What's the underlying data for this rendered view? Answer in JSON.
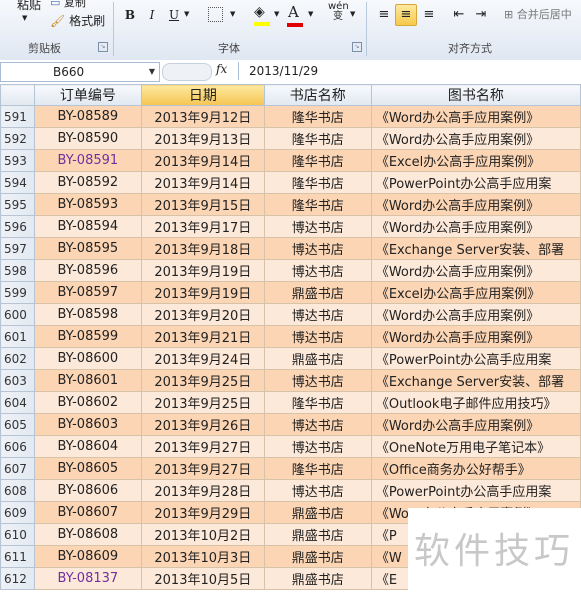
{
  "ribbon": {
    "clipboard": {
      "paste": "粘贴",
      "copy": "复制",
      "format_painter": "格式刷",
      "group": "剪贴板"
    },
    "font": {
      "group": "字体",
      "bold": "B",
      "italic": "I",
      "underline": "U",
      "wen": "wén 变"
    },
    "align": {
      "group": "对齐方式",
      "merge": "合并后居中"
    }
  },
  "formula_bar": {
    "name_box": "B660",
    "fx": "fx",
    "content": "2013/11/29"
  },
  "columns": {
    "a": "订单编号",
    "b": "日期",
    "c": "书店名称",
    "d": "图书名称"
  },
  "rows": [
    {
      "n": "591",
      "id": "BY-08589",
      "date": "2013年9月12日",
      "store": "隆华书店",
      "book": "《Word办公高手应用案例》"
    },
    {
      "n": "592",
      "id": "BY-08590",
      "date": "2013年9月13日",
      "store": "隆华书店",
      "book": "《Word办公高手应用案例》"
    },
    {
      "n": "593",
      "id": "BY-08591",
      "date": "2013年9月14日",
      "store": "隆华书店",
      "book": "《Excel办公高手应用案例》"
    },
    {
      "n": "594",
      "id": "BY-08592",
      "date": "2013年9月14日",
      "store": "隆华书店",
      "book": "《PowerPoint办公高手应用案"
    },
    {
      "n": "595",
      "id": "BY-08593",
      "date": "2013年9月15日",
      "store": "隆华书店",
      "book": "《Word办公高手应用案例》"
    },
    {
      "n": "596",
      "id": "BY-08594",
      "date": "2013年9月17日",
      "store": "博达书店",
      "book": "《Word办公高手应用案例》"
    },
    {
      "n": "597",
      "id": "BY-08595",
      "date": "2013年9月18日",
      "store": "博达书店",
      "book": "《Exchange Server安装、部署"
    },
    {
      "n": "598",
      "id": "BY-08596",
      "date": "2013年9月19日",
      "store": "博达书店",
      "book": "《Word办公高手应用案例》"
    },
    {
      "n": "599",
      "id": "BY-08597",
      "date": "2013年9月19日",
      "store": "鼎盛书店",
      "book": "《Excel办公高手应用案例》"
    },
    {
      "n": "600",
      "id": "BY-08598",
      "date": "2013年9月20日",
      "store": "博达书店",
      "book": "《Word办公高手应用案例》"
    },
    {
      "n": "601",
      "id": "BY-08599",
      "date": "2013年9月21日",
      "store": "博达书店",
      "book": "《Word办公高手应用案例》"
    },
    {
      "n": "602",
      "id": "BY-08600",
      "date": "2013年9月24日",
      "store": "鼎盛书店",
      "book": "《PowerPoint办公高手应用案"
    },
    {
      "n": "603",
      "id": "BY-08601",
      "date": "2013年9月25日",
      "store": "博达书店",
      "book": "《Exchange Server安装、部署"
    },
    {
      "n": "604",
      "id": "BY-08602",
      "date": "2013年9月25日",
      "store": "隆华书店",
      "book": "《Outlook电子邮件应用技巧》"
    },
    {
      "n": "605",
      "id": "BY-08603",
      "date": "2013年9月26日",
      "store": "博达书店",
      "book": "《Word办公高手应用案例》"
    },
    {
      "n": "606",
      "id": "BY-08604",
      "date": "2013年9月27日",
      "store": "博达书店",
      "book": "《OneNote万用电子笔记本》"
    },
    {
      "n": "607",
      "id": "BY-08605",
      "date": "2013年9月27日",
      "store": "隆华书店",
      "book": "《Office商务办公好帮手》"
    },
    {
      "n": "608",
      "id": "BY-08606",
      "date": "2013年9月28日",
      "store": "博达书店",
      "book": "《PowerPoint办公高手应用案"
    },
    {
      "n": "609",
      "id": "BY-08607",
      "date": "2013年9月29日",
      "store": "鼎盛书店",
      "book": "《Word办公高手应用案例》"
    },
    {
      "n": "610",
      "id": "BY-08608",
      "date": "2013年10月2日",
      "store": "鼎盛书店",
      "book": "《P"
    },
    {
      "n": "611",
      "id": "BY-08609",
      "date": "2013年10月3日",
      "store": "鼎盛书店",
      "book": "《W"
    },
    {
      "n": "612",
      "id": "BY-08137",
      "date": "2013年10月5日",
      "store": "鼎盛书店",
      "book": "《E"
    }
  ],
  "purple_ids": [
    "BY-08591",
    "BY-08137"
  ],
  "watermark": "软件技巧",
  "colors": {
    "row_odd": "#fcd5b4",
    "row_even": "#fde9d9",
    "selected_header": "#f5c451",
    "link_purple": "#7030a0"
  }
}
